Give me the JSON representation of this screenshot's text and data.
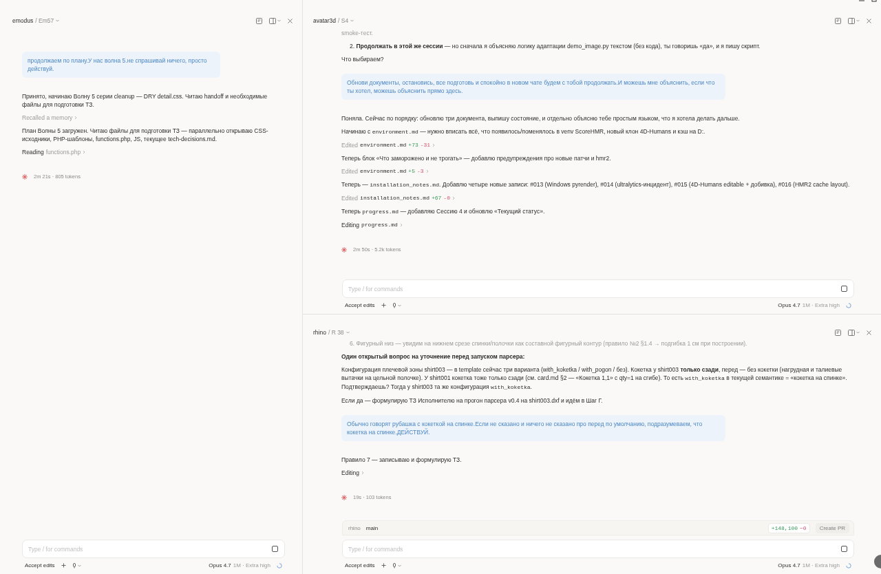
{
  "window_controls": {
    "minimize": true,
    "maximize": true
  },
  "panes": [
    {
      "header": {
        "project": "emodus",
        "session": "/ Em57"
      },
      "messages": [
        {
          "kind": "user",
          "text": "продолжаем по плану.У нас волна 5.не спрашивай ничего, просто действуй."
        },
        {
          "kind": "text",
          "parts": [
            {
              "kind": "plain",
              "text": "Принято, начинаю Волну 5 серии cleanup — DRY detail.css. Читаю handoff и необходимые файлы для подготовки ТЗ."
            }
          ]
        },
        {
          "kind": "tool",
          "verb": "Recalled a memory",
          "done": true
        },
        {
          "kind": "text",
          "parts": [
            {
              "kind": "plain",
              "text": "План Волны 5 загружен. Читаю файлы для подготовки ТЗ — параллельно открываю CSS-исходники, PHP-шаблоны, functions.php, JS, текущее tech-decisions.md."
            }
          ]
        },
        {
          "kind": "tool",
          "verb": "Reading",
          "target": "functions.php",
          "target_code": false,
          "done": false
        },
        {
          "kind": "status",
          "text": "2m 21s · 805 tokens"
        }
      ],
      "composer": {
        "placeholder": "Type / for commands",
        "accept": "Accept edits",
        "model": "Opus 4.7",
        "detail": "1M · Extra high"
      }
    },
    {
      "header": {
        "project": "avatar3d",
        "session": "/ S4"
      },
      "messages": [
        {
          "kind": "text",
          "faded": true,
          "parts": [
            {
              "kind": "plain",
              "text": "smoke-тест."
            }
          ]
        },
        {
          "kind": "list_item",
          "number": "2.",
          "text": "**Продолжать в этой же сессии** — но сначала я объясняю логику адаптации demo_image.py текстом (без кода), ты говоришь «да», и я пишу скрипт."
        },
        {
          "kind": "text",
          "parts": [
            {
              "kind": "plain",
              "text": "Что выбираем?"
            }
          ]
        },
        {
          "kind": "user",
          "text": "Обнови документы, остановись, все подготовь и спокойно в новом чате будем с тобой продолжать.И можешь мне объяснить, если что ты хотел, можешь объяснить прямо здесь."
        },
        {
          "kind": "text",
          "parts": [
            {
              "kind": "plain",
              "text": "Поняла. Сейчас по порядку: обновлю три документа, выпишу состояние, и отдельно объясню тебе простым языком, что я хотела делать дальше."
            }
          ]
        },
        {
          "kind": "text",
          "parts": [
            {
              "kind": "plain",
              "text": "Начинаю с "
            },
            {
              "kind": "code",
              "text": "environment.md"
            },
            {
              "kind": "plain",
              "text": " — нужно вписать всё, что появилось/поменялось в venv ScoreHMR, новый клон 4D-Humans и кэш на D:."
            }
          ]
        },
        {
          "kind": "tool",
          "verb": "Edited",
          "target": "environment.md",
          "target_code": true,
          "added": "+73",
          "removed": "-31",
          "done": true
        },
        {
          "kind": "text",
          "parts": [
            {
              "kind": "plain",
              "text": "Теперь блок «Что заморожено и не трогать» — добавлю предупреждения про новые патчи и hmr2."
            }
          ]
        },
        {
          "kind": "tool",
          "verb": "Edited",
          "target": "environment.md",
          "target_code": true,
          "added": "+5",
          "removed": "-3",
          "done": true
        },
        {
          "kind": "text",
          "parts": [
            {
              "kind": "plain",
              "text": "Теперь — "
            },
            {
              "kind": "code",
              "text": "installation_notes.md"
            },
            {
              "kind": "plain",
              "text": ". Добавлю четыре новые записи: #013 (Windows pyrender), #014 (ultralytics-инцидент), #015 (4D-Humans editable + добивка), #016 (HMR2 cache layout)."
            }
          ]
        },
        {
          "kind": "tool",
          "verb": "Edited",
          "target": "installation_notes.md",
          "target_code": true,
          "added": "+67",
          "removed": "-0",
          "done": true
        },
        {
          "kind": "text",
          "parts": [
            {
              "kind": "plain",
              "text": "Теперь "
            },
            {
              "kind": "code",
              "text": "progress.md"
            },
            {
              "kind": "plain",
              "text": " — добавляю Сессию 4 и обновлю «Текущий статус»."
            }
          ]
        },
        {
          "kind": "tool",
          "verb": "Editing",
          "target": "progress.md",
          "target_code": true,
          "done": false
        },
        {
          "kind": "status",
          "text": "2m 50s · 5.2k tokens"
        }
      ],
      "composer": {
        "placeholder": "Type / for commands",
        "accept": "Accept edits",
        "model": "Opus 4.7",
        "detail": "1M · Extra high"
      }
    },
    {
      "header": {
        "project": "rhino",
        "session": "/ R 38"
      },
      "messages": [
        {
          "kind": "list_item",
          "faded": true,
          "number": "6.",
          "text": "Фигурный низ — увидим на нижнем срезе спинки/полочки как составной фигурный контур (правило №2 §1.4 → подгибка 1 см при построении)."
        },
        {
          "kind": "text",
          "strong": true,
          "parts": [
            {
              "kind": "plain",
              "text": "Один открытый вопрос на уточнение перед запуском парсера:"
            }
          ]
        },
        {
          "kind": "text",
          "parts": [
            {
              "kind": "plain",
              "text": "Конфигурация плечевой зоны shirt003 — в template сейчас три варианта (with_koketka / with_pogon / без). Кокетка у shirt003 **только сзади**, перед — без кокетки (нагрудная и талиевые вытачки на цельной полочке). У shirt001 кокетка тоже только сзади (см. card.md §2 — «Кокетка 1,1» с qty=1 на сгибе). То есть "
            },
            {
              "kind": "code",
              "text": "with_koketka"
            },
            {
              "kind": "plain",
              "text": " в текущей семантике = «кокетка на спинке». Подтверждаешь? Тогда у shirt003 та же конфигурация "
            },
            {
              "kind": "code",
              "text": "with_koketka"
            },
            {
              "kind": "plain",
              "text": "."
            }
          ]
        },
        {
          "kind": "text",
          "parts": [
            {
              "kind": "plain",
              "text": "Если да — формулирую ТЗ Исполнителю на прогон парсера v0.4 на shirt003.dxf и идём в Шаг Г."
            }
          ]
        },
        {
          "kind": "user",
          "text": "Обычно говорят рубашка с кокеткой на спинке.Если не сказано и ничего не сказано про перед по умолчанию, подразумеваем, что кокетка на спинке.ДЕЙСТВУЙ."
        },
        {
          "kind": "text",
          "parts": [
            {
              "kind": "plain",
              "text": "Правило 7 — записываю и формулирую ТЗ."
            }
          ]
        },
        {
          "kind": "tool",
          "verb": "Editing",
          "done": false
        },
        {
          "kind": "status",
          "text": "19s · 103 tokens"
        }
      ],
      "branch_bar": {
        "repo": "rhino",
        "branch": "main",
        "added": "+148,100",
        "removed": "−0",
        "create_pr": {
          "label": "Create PR",
          "disabled": true
        }
      },
      "composer": {
        "placeholder": "Type / for commands",
        "accept": "Accept edits",
        "model": "Opus 4.7",
        "detail": "1M · Extra high"
      }
    }
  ]
}
